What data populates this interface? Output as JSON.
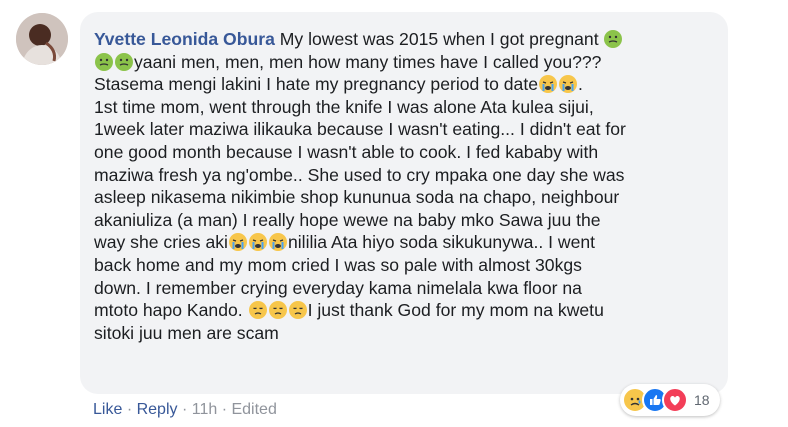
{
  "comment": {
    "author": "Yvette Leonida Obura",
    "lines": [
      "My lowest was 2015 when I got pregnant ",
      "yaani men, men, men how many times have I called you???",
      "Stasema mengi lakini I hate my pregnancy period to date",
      "1st time mom, went through the knife I was alone Ata kulea sijui,",
      "1week later maziwa ilikauka because I wasn't eating... I didn't eat for",
      "one good month because I wasn't able to cook. I fed kababy with",
      "maziwa fresh ya ng'ombe.. She used to cry mpaka one day she was",
      "asleep nikasema nikimbie shop kununua soda na chapo, neighbour",
      "akaniuliza (a man) I really hope wewe na baby mko Sawa juu the",
      "way she cries aki",
      "nililia Ata hiyo soda sikukunywa.. I went",
      "back home and my mom cried I was so pale with almost 30kgs",
      "down. I remember crying everyday kama nimelala kwa floor na",
      "mtoto hapo Kando. ",
      "I just thank God for my mom na kwetu",
      "sitoki juu men are scam"
    ],
    "trailing_dot": "."
  },
  "actions": {
    "like": "Like",
    "reply": "Reply",
    "time": "11h",
    "edited": "Edited",
    "separator": "·"
  },
  "reactions": {
    "count": "18",
    "types": [
      "sad",
      "like",
      "love"
    ],
    "colors": {
      "sad": "#f7c64b",
      "like": "#1877f2",
      "love": "#f33e58"
    }
  },
  "emojis": [
    "nauseated-face",
    "crying-face",
    "disappointed-face"
  ]
}
